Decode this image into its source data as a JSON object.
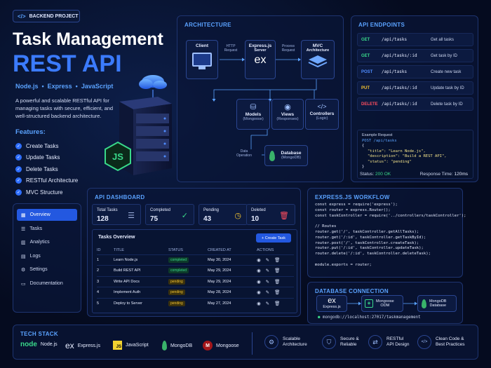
{
  "header": {
    "badge": "BACKEND PROJECT",
    "badge_icon": "</>",
    "title_line1": "Task Management",
    "title_line2": "REST API",
    "tech_line": "Node.js  •  Express  •  JavaScript",
    "description": "A powerful and scalable RESTful API for managing tasks with secure, efficient, and well-structured backend architecture.",
    "features_title": "Features:",
    "features": [
      "Create Tasks",
      "Update Tasks",
      "Delete Tasks",
      "RESTful Architecture",
      "MVC Structure"
    ]
  },
  "architecture": {
    "title": "ARCHITECTURE",
    "client": "Client",
    "express_title": "Express.js",
    "express_sub": "Server",
    "express_logo": "ex",
    "mvc_title": "MVC",
    "mvc_sub": "Architecture",
    "http_label": "HTTP\nRequest",
    "process_label": "Process\nRequest",
    "models": "Models",
    "models_sub": "(Mongoose)",
    "views": "Views",
    "views_sub": "(Responses)",
    "controllers": "Controllers",
    "controllers_sub": "(Logic)",
    "data_op": "Data\nOperation",
    "database": "Database",
    "database_sub": "(MongoDB)"
  },
  "api": {
    "title": "API ENDPOINTS",
    "endpoints": [
      {
        "method": "GET",
        "path": "/api/tasks",
        "desc": "Get all tasks",
        "color": "#39d98a"
      },
      {
        "method": "GET",
        "path": "/api/tasks/:id",
        "desc": "Get task by ID",
        "color": "#39d98a"
      },
      {
        "method": "POST",
        "path": "/api/tasks",
        "desc": "Create new task",
        "color": "#4f8cff"
      },
      {
        "method": "PUT",
        "path": "/api/tasks/:id",
        "desc": "Update task by ID",
        "color": "#f2c230"
      },
      {
        "method": "DELETE",
        "path": "/api/tasks/:id",
        "desc": "Delete task by ID",
        "color": "#ff4d5e"
      }
    ],
    "example_label": "Example Request",
    "example_line": "POST /api/tasks",
    "body_open": "{",
    "body_title": "\"title\": \"Learn Node.js\",",
    "body_desc": "\"description\": \"Build a REST API\",",
    "body_status": "\"status\": \"pending\"",
    "body_close": "}",
    "status_label": "Status:",
    "status_value": "200 OK",
    "time_label": "Response Time:",
    "time_value": "120ms"
  },
  "sidebar": {
    "items": [
      {
        "label": "Overview",
        "icon": "▦"
      },
      {
        "label": "Tasks",
        "icon": "☰"
      },
      {
        "label": "Analytics",
        "icon": "▥"
      },
      {
        "label": "Logs",
        "icon": "▤"
      },
      {
        "label": "Settings",
        "icon": "⚙"
      },
      {
        "label": "Documentation",
        "icon": "▭"
      }
    ]
  },
  "dashboard": {
    "title": "API DASHBOARD",
    "stats": [
      {
        "label": "Total Tasks",
        "value": "128",
        "icon": "☰",
        "color": "#9fb2e0"
      },
      {
        "label": "Completed",
        "value": "75",
        "icon": "✓",
        "color": "#39d98a"
      },
      {
        "label": "Pending",
        "value": "43",
        "icon": "◷",
        "color": "#f2c230"
      },
      {
        "label": "Deleted",
        "value": "10",
        "icon": "🗑",
        "color": "#ff4d5e"
      }
    ],
    "overview_title": "Tasks Overview",
    "create_button": "+ Create Task",
    "columns": [
      "ID",
      "TITLE",
      "STATUS",
      "CREATED AT",
      "ACTIONS"
    ],
    "rows": [
      {
        "id": "1",
        "title": "Learn Node.js",
        "status": "completed",
        "date": "May 30, 2024"
      },
      {
        "id": "2",
        "title": "Build REST API",
        "status": "completed",
        "date": "May 29, 2024"
      },
      {
        "id": "3",
        "title": "Write API Docs",
        "status": "pending",
        "date": "May 29, 2024"
      },
      {
        "id": "4",
        "title": "Implement Auth",
        "status": "pending",
        "date": "May 28, 2024"
      },
      {
        "id": "5",
        "title": "Deploy to Server",
        "status": "pending",
        "date": "May 27, 2024"
      }
    ]
  },
  "workflow": {
    "title": "EXPRESS.JS WORKFLOW",
    "code": "const express = require('express');\nconst router = express.Router();\nconst taskController = require('../controllers/taskController');\n\n// Routes\nrouter.get('/', taskController.getAllTasks);\nrouter.get('/:id', taskController.getTaskById);\nrouter.post('/', taskController.createTask);\nrouter.put('/:id', taskController.updateTask);\nrouter.delete('/:id', taskController.deleteTask);\n\nmodule.exports = router;"
  },
  "dbconn": {
    "title": "DATABASE CONNECTION",
    "express": "Express.js",
    "express_logo": "ex",
    "mongoose": "Mongoose\nODM",
    "mongodb": "MongoDB\nDatabase",
    "uri": "mongodb://localhost:27017/taskmanagement"
  },
  "stack": {
    "title": "TECH STACK",
    "items": [
      {
        "label": "Node.js",
        "logo": "node"
      },
      {
        "label": "Express.js",
        "logo": "ex"
      },
      {
        "label": "JavaScript",
        "logo": "JS"
      },
      {
        "label": "MongoDB",
        "logo": ""
      },
      {
        "label": "Mongoose",
        "logo": "M"
      }
    ],
    "highlights": [
      {
        "label": "Scalable\nArchitecture",
        "icon": "⚙"
      },
      {
        "label": "Secure &\nReliable",
        "icon": "⛉"
      },
      {
        "label": "RESTful\nAPI Design",
        "icon": "⇄"
      },
      {
        "label": "Clean Code &\nBest Practices",
        "icon": "</>"
      }
    ]
  }
}
